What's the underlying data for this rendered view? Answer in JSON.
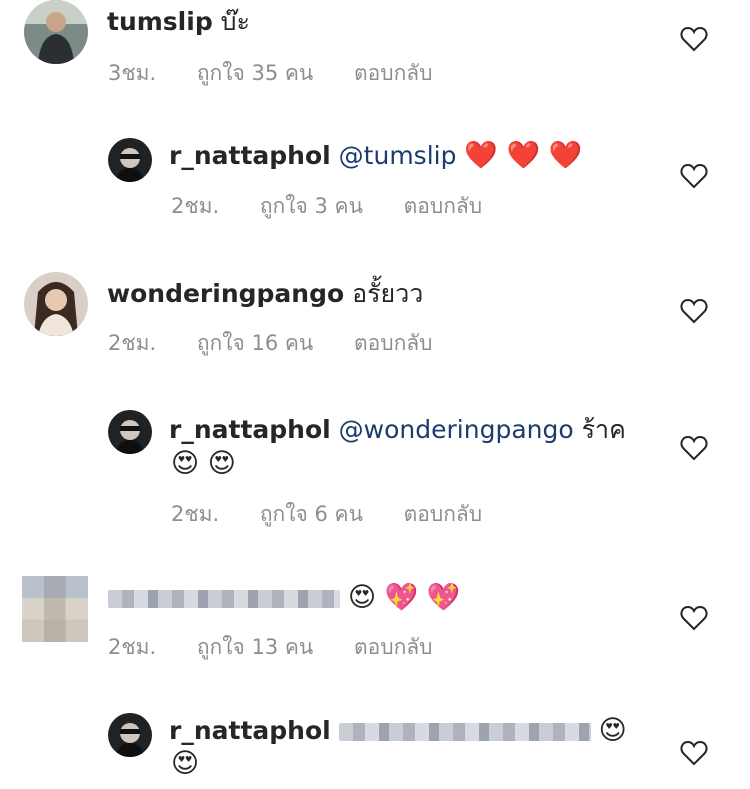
{
  "comments": [
    {
      "username": "tumslip",
      "text": "บ๊ะ",
      "time": "3ชม.",
      "likes": "ถูกใจ 35 คน",
      "reply": "ตอบกลับ"
    },
    {
      "username": "r_nattaphol",
      "mention": "@tumslip",
      "emoji": "❤️ ❤️ ❤️",
      "time": "2ชม.",
      "likes": "ถูกใจ 3 คน",
      "reply": "ตอบกลับ"
    },
    {
      "username": "wonderingpango",
      "text": "อรั้ยวว",
      "time": "2ชม.",
      "likes": "ถูกใจ 16 คน",
      "reply": "ตอบกลับ"
    },
    {
      "username": "r_nattaphol",
      "mention": "@wonderingpango",
      "text": "ร้าค",
      "emoji": "😍 😍",
      "time": "2ชม.",
      "likes": "ถูกใจ 6 คน",
      "reply": "ตอบกลับ"
    },
    {
      "emoji": "😍 💖 💖",
      "time": "2ชม.",
      "likes": "ถูกใจ 13 คน",
      "reply": "ตอบกลับ"
    },
    {
      "username": "r_nattaphol",
      "emoji1": "😍",
      "emoji2": "😍"
    }
  ]
}
